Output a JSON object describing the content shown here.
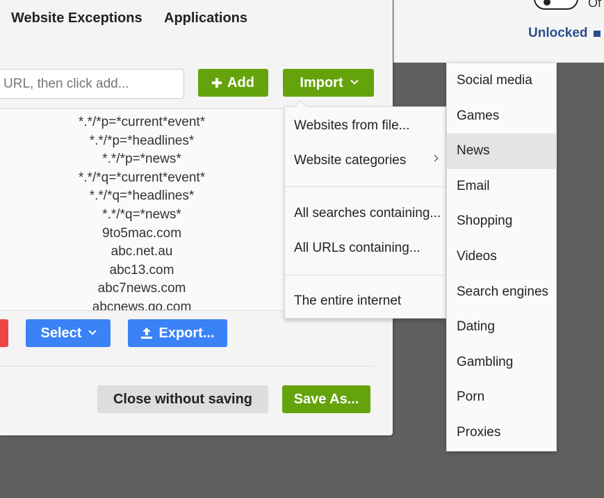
{
  "background": {
    "toggle_text": "Of",
    "unlocked_label": "Unlocked"
  },
  "tabs": [
    {
      "label": "Website Exceptions"
    },
    {
      "label": "Applications"
    }
  ],
  "url_input": {
    "placeholder": "URL, then click add..."
  },
  "buttons": {
    "add": "Add",
    "import": "Import",
    "select": "Select",
    "export": "Export...",
    "close_without_saving": "Close without saving",
    "save_as": "Save As..."
  },
  "list": [
    "*.*/*p=*current*event*",
    "*.*/*p=*headlines*",
    "*.*/*p=*news*",
    "*.*/*q=*current*event*",
    "*.*/*q=*headlines*",
    "*.*/*q=*news*",
    "9to5mac.com",
    "abc.net.au",
    "abc13.com",
    "abc7news.com",
    "abcnews.go.com"
  ],
  "import_menu": {
    "items": [
      "Websites from file...",
      "Website categories",
      "All searches containing...",
      "All URLs containing...",
      "The entire internet"
    ]
  },
  "categories": {
    "items": [
      "Social media",
      "Games",
      "News",
      "Email",
      "Shopping",
      "Videos",
      "Search engines",
      "Dating",
      "Gambling",
      "Porn",
      "Proxies"
    ],
    "active": "News"
  },
  "colors": {
    "green": "#65a30d",
    "blue": "#3b82f6",
    "red": "#ef4444",
    "link_blue": "#2c4f8c"
  },
  "icons": [
    "plus-icon",
    "chevron-down-icon",
    "upload-icon",
    "chevron-right-icon",
    "lock-icon"
  ]
}
